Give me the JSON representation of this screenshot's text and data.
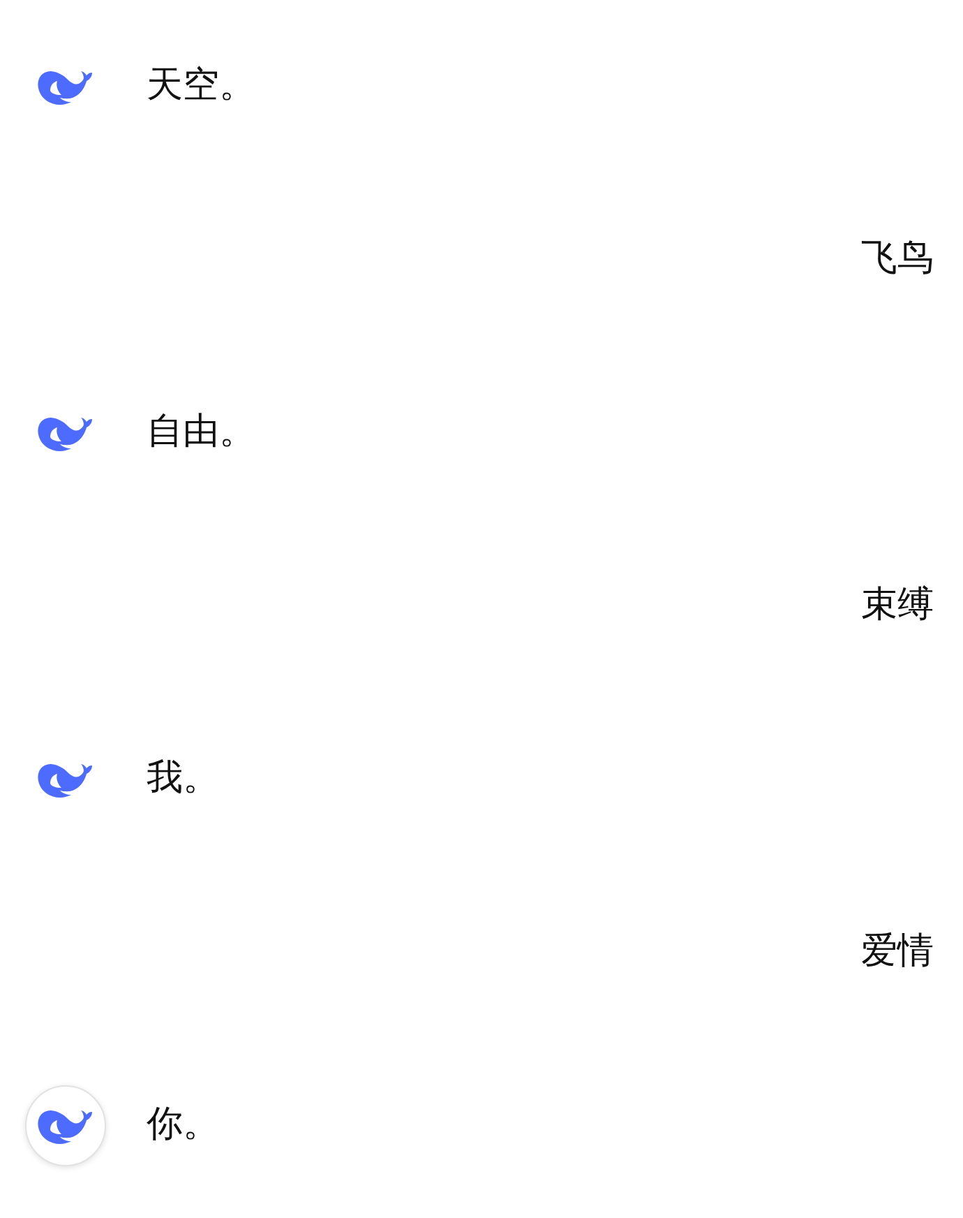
{
  "messages": [
    {
      "kind": "assistant",
      "text": "天空。",
      "active": false
    },
    {
      "kind": "user",
      "text": "飞鸟"
    },
    {
      "kind": "assistant",
      "text": "自由。",
      "active": false
    },
    {
      "kind": "user",
      "text": "束缚"
    },
    {
      "kind": "assistant",
      "text": "我。",
      "active": false
    },
    {
      "kind": "user",
      "text": "爱情"
    },
    {
      "kind": "assistant",
      "text": "你。",
      "active": true
    }
  ]
}
